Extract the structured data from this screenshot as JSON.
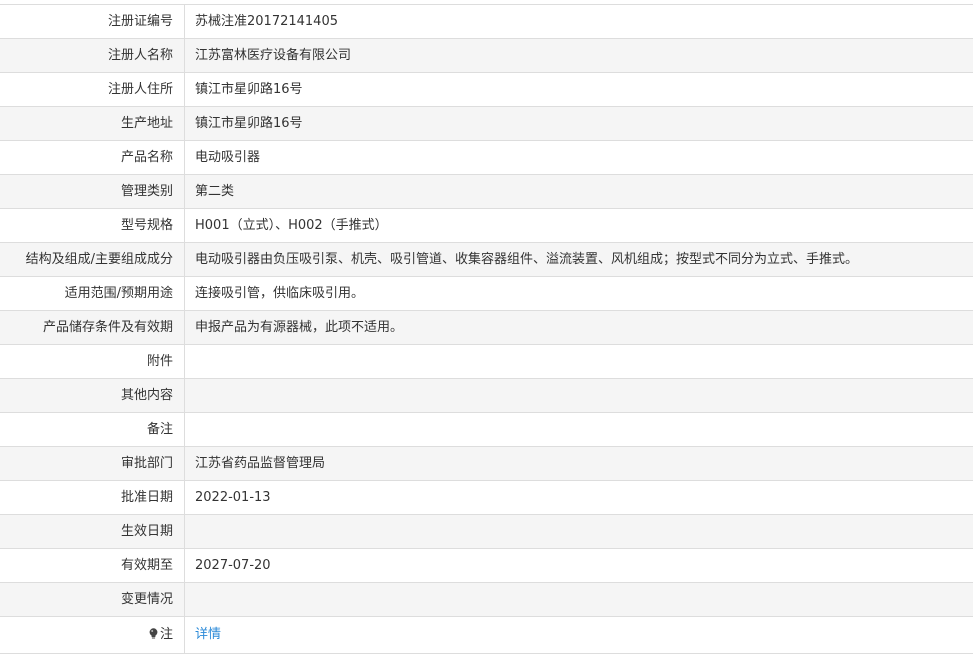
{
  "rows": [
    {
      "label": "注册证编号",
      "value": "苏械注准20172141405"
    },
    {
      "label": "注册人名称",
      "value": "江苏富林医疗设备有限公司"
    },
    {
      "label": "注册人住所",
      "value": "镇江市星卯路16号"
    },
    {
      "label": "生产地址",
      "value": "镇江市星卯路16号"
    },
    {
      "label": "产品名称",
      "value": "电动吸引器"
    },
    {
      "label": "管理类别",
      "value": "第二类"
    },
    {
      "label": "型号规格",
      "value": "H001（立式）、H002（手推式）"
    },
    {
      "label": "结构及组成/主要组成成分",
      "value": "电动吸引器由负压吸引泵、机壳、吸引管道、收集容器组件、溢流装置、风机组成；按型式不同分为立式、手推式。"
    },
    {
      "label": "适用范围/预期用途",
      "value": "连接吸引管，供临床吸引用。"
    },
    {
      "label": "产品储存条件及有效期",
      "value": "申报产品为有源器械，此项不适用。"
    },
    {
      "label": "附件",
      "value": ""
    },
    {
      "label": "其他内容",
      "value": ""
    },
    {
      "label": "备注",
      "value": ""
    },
    {
      "label": "审批部门",
      "value": "江苏省药品监督管理局"
    },
    {
      "label": "批准日期",
      "value": "2022-01-13"
    },
    {
      "label": "生效日期",
      "value": ""
    },
    {
      "label": "有效期至",
      "value": "2027-07-20"
    },
    {
      "label": "变更情况",
      "value": ""
    }
  ],
  "note": {
    "label": "注",
    "icon": "lightbulb-icon",
    "link": "详情",
    "link_color": "#2b8ad8"
  }
}
